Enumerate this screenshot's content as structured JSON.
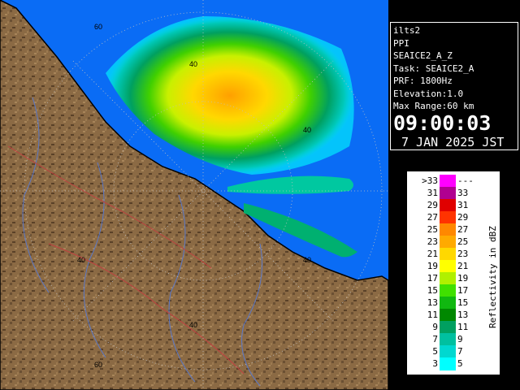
{
  "info": {
    "radar": "ilts2",
    "mode": "PPI",
    "product": "SEAICE2_A_Z",
    "task": "Task: SEAICE2_A",
    "prf": "PRF: 1800Hz",
    "elevation": "Elevation:1.0",
    "max_range": "Max Range:60 km",
    "time": "09:00:03",
    "date": "7 JAN 2025 JST"
  },
  "map": {
    "range_rings": [
      {
        "label": "60",
        "text_key": "r60a"
      },
      {
        "label": "40",
        "text_key": "r40a"
      }
    ],
    "ring_labels": [
      "60",
      "40",
      "40",
      "40",
      "40",
      "40",
      "60"
    ],
    "colors": {
      "sea": "#0a6cf5",
      "land": "#8b6a44",
      "land_dark": "#5a4128",
      "ring": "#c0c0c0",
      "coast": "#000000"
    }
  },
  "legend": {
    "unit_label": "Reflectivity in dBZ",
    "rows": [
      {
        "left": ">33",
        "right": "---",
        "color": "#ff00ff"
      },
      {
        "left": "31",
        "right": "33",
        "color": "#b00090"
      },
      {
        "left": "29",
        "right": "31",
        "color": "#e00000"
      },
      {
        "left": "27",
        "right": "29",
        "color": "#ff3300"
      },
      {
        "left": "25",
        "right": "27",
        "color": "#ff8800"
      },
      {
        "left": "23",
        "right": "25",
        "color": "#ffaa00"
      },
      {
        "left": "21",
        "right": "23",
        "color": "#ffd800"
      },
      {
        "left": "19",
        "right": "21",
        "color": "#ffff00"
      },
      {
        "left": "17",
        "right": "19",
        "color": "#b0f000"
      },
      {
        "left": "15",
        "right": "17",
        "color": "#40e000"
      },
      {
        "left": "13",
        "right": "15",
        "color": "#10b810"
      },
      {
        "left": "11",
        "right": "13",
        "color": "#008800"
      },
      {
        "left": "9",
        "right": "11",
        "color": "#00a060"
      },
      {
        "left": "7",
        "right": "9",
        "color": "#00c0a0"
      },
      {
        "left": "5",
        "right": "7",
        "color": "#00d8d0"
      },
      {
        "left": "3",
        "right": "5",
        "color": "#00ffff"
      }
    ]
  }
}
